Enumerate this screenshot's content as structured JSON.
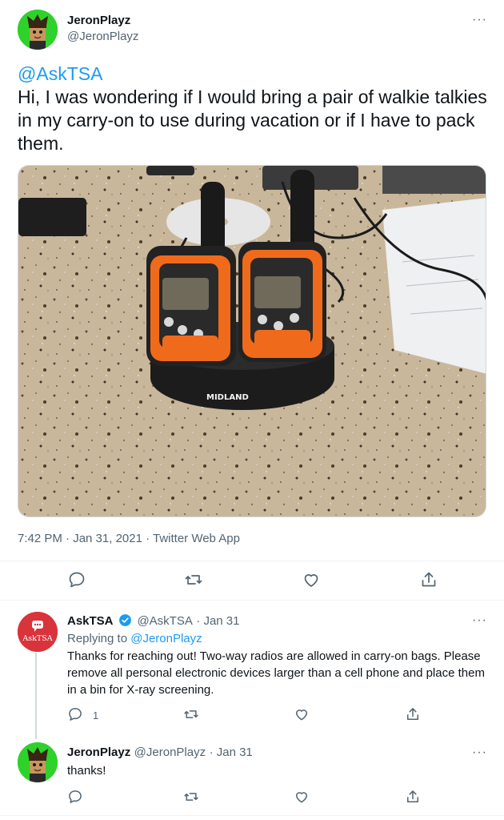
{
  "main_tweet": {
    "author_name": "JeronPlayz",
    "author_handle": "@JeronPlayz",
    "mention": "@AskTSA",
    "text": "Hi, I was wondering if I would bring a pair of walkie talkies in my carry-on to use during vacation or if I have to pack them.",
    "photo_brand_label": "MIDLAND",
    "timestamp": "7:42 PM · Jan 31, 2021 · Twitter Web App"
  },
  "reply_tsa": {
    "author_name": "AskTSA",
    "author_handle": "@AskTSA",
    "date": "· Jan 31",
    "avatar_label": "AskTSA",
    "replying_prefix": "Replying to",
    "replying_to": "@JeronPlayz",
    "text": "Thanks for reaching out! Two-way radios are allowed in carry-on bags. Please remove all personal electronic devices larger than a cell phone and place them in a bin for X-ray screening.",
    "reply_count": "1"
  },
  "reply_jeron": {
    "author_name": "JeronPlayz",
    "author_handle": "@JeronPlayz",
    "date": "· Jan 31",
    "text": "thanks!"
  },
  "ui": {
    "more_glyph": "···",
    "accent_color": "#1d9bf0",
    "icons": [
      "reply-icon",
      "retweet-icon",
      "like-icon",
      "share-icon",
      "verified-badge-icon",
      "more-icon"
    ]
  }
}
